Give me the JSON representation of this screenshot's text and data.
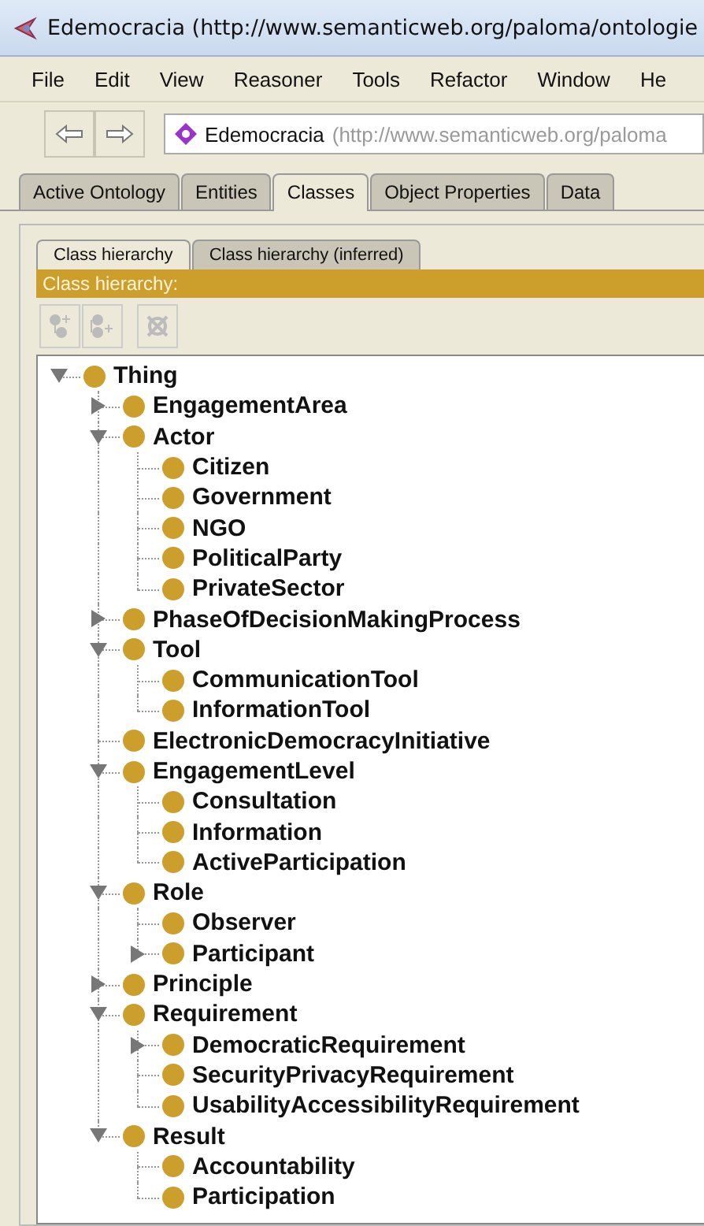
{
  "window": {
    "title": "Edemocracia (http://www.semanticweb.org/paloma/ontologie"
  },
  "menu": [
    "File",
    "Edit",
    "View",
    "Reasoner",
    "Tools",
    "Refactor",
    "Window",
    "He"
  ],
  "address": {
    "name": "Edemocracia",
    "iri": "(http://www.semanticweb.org/paloma"
  },
  "tabs": [
    {
      "label": "Active Ontology",
      "selected": false
    },
    {
      "label": "Entities",
      "selected": false
    },
    {
      "label": "Classes",
      "selected": true
    },
    {
      "label": "Object Properties",
      "selected": false
    },
    {
      "label": "Data",
      "selected": false
    }
  ],
  "subtabs": [
    {
      "label": "Class hierarchy",
      "selected": true
    },
    {
      "label": "Class hierarchy (inferred)",
      "selected": false
    }
  ],
  "panel_header": "Class hierarchy:",
  "toolbar": [
    {
      "kind": "add-subclass",
      "disabled": true
    },
    {
      "kind": "add-sibling",
      "disabled": true
    },
    {
      "kind": "delete",
      "disabled": true
    }
  ],
  "tree": [
    {
      "label": "Thing",
      "kind": "branch",
      "expanded": true,
      "children": [
        {
          "label": "EngagementArea",
          "kind": "branch",
          "expanded": false
        },
        {
          "label": "Actor",
          "kind": "branch",
          "expanded": true,
          "children": [
            {
              "label": "Citizen",
              "kind": "leaf"
            },
            {
              "label": "Government",
              "kind": "leaf"
            },
            {
              "label": "NGO",
              "kind": "leaf"
            },
            {
              "label": "PoliticalParty",
              "kind": "leaf"
            },
            {
              "label": "PrivateSector",
              "kind": "leaf"
            }
          ]
        },
        {
          "label": "PhaseOfDecisionMakingProcess",
          "kind": "branch",
          "expanded": false
        },
        {
          "label": "Tool",
          "kind": "branch",
          "expanded": true,
          "children": [
            {
              "label": "CommunicationTool",
              "kind": "leaf"
            },
            {
              "label": "InformationTool",
              "kind": "leaf"
            }
          ]
        },
        {
          "label": "ElectronicDemocracyInitiative",
          "kind": "leaf"
        },
        {
          "label": "EngagementLevel",
          "kind": "branch",
          "expanded": true,
          "children": [
            {
              "label": "Consultation",
              "kind": "leaf"
            },
            {
              "label": "Information",
              "kind": "leaf"
            },
            {
              "label": "ActiveParticipation",
              "kind": "leaf"
            }
          ]
        },
        {
          "label": "Role",
          "kind": "branch",
          "expanded": true,
          "children": [
            {
              "label": "Observer",
              "kind": "leaf"
            },
            {
              "label": "Participant",
              "kind": "branch",
              "expanded": false
            }
          ]
        },
        {
          "label": "Principle",
          "kind": "branch",
          "expanded": false
        },
        {
          "label": "Requirement",
          "kind": "branch",
          "expanded": true,
          "children": [
            {
              "label": "DemocraticRequirement",
              "kind": "branch",
              "expanded": false
            },
            {
              "label": "SecurityPrivacyRequirement",
              "kind": "leaf"
            },
            {
              "label": "UsabilityAccessibilityRequirement",
              "kind": "leaf"
            }
          ]
        },
        {
          "label": "Result",
          "kind": "branch",
          "expanded": true,
          "children": [
            {
              "label": "Accountability",
              "kind": "leaf"
            },
            {
              "label": "Participation",
              "kind": "leaf"
            }
          ]
        }
      ]
    }
  ]
}
